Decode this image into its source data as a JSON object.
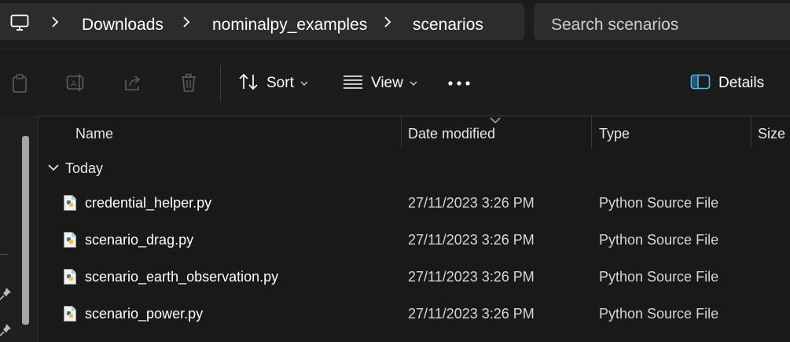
{
  "breadcrumb": [
    "Downloads",
    "nominalpy_examples",
    "scenarios"
  ],
  "search": {
    "placeholder": "Search scenarios"
  },
  "toolbar": {
    "sort_label": "Sort",
    "view_label": "View",
    "details_label": "Details"
  },
  "columns": {
    "name": "Name",
    "date_modified": "Date modified",
    "type": "Type",
    "size": "Size"
  },
  "group": {
    "label": "Today"
  },
  "files": [
    {
      "name": "credential_helper.py",
      "date": "27/11/2023 3:26 PM",
      "type": "Python Source File"
    },
    {
      "name": "scenario_drag.py",
      "date": "27/11/2023 3:26 PM",
      "type": "Python Source File"
    },
    {
      "name": "scenario_earth_observation.py",
      "date": "27/11/2023 3:26 PM",
      "type": "Python Source File"
    },
    {
      "name": "scenario_power.py",
      "date": "27/11/2023 3:26 PM",
      "type": "Python Source File"
    }
  ],
  "icons": [
    "monitor-icon",
    "chevron-right-icon",
    "copy-icon",
    "rename-icon",
    "share-icon",
    "delete-icon",
    "sort-icon",
    "view-icon",
    "more-icon",
    "details-pane-icon",
    "pin-icon",
    "chevron-down-icon",
    "python-file-icon"
  ],
  "colors": {
    "accent": "#4cc2ff",
    "background": "#191919",
    "bar": "#2c2c2c"
  }
}
